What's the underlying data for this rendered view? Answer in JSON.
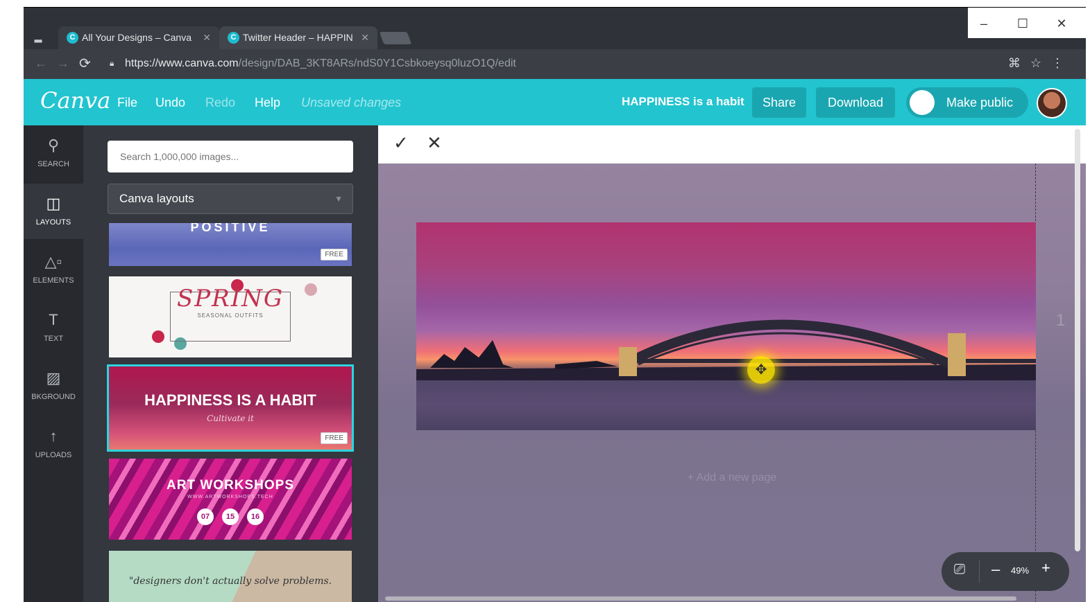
{
  "browser": {
    "tabs": [
      {
        "title": "All Your Designs – Canva",
        "favicon": "C"
      },
      {
        "title": "Twitter Header – HAPPIN",
        "favicon": "C"
      }
    ],
    "url_host": "https://www.canva.com",
    "url_path": "/design/DAB_3KT8ARs/ndS0Y1Csbkoeysq0luzO1Q/edit",
    "controls": {
      "minimize": "–",
      "maximize": "☐",
      "close": "✕"
    }
  },
  "header": {
    "logo": "Canva",
    "menu": {
      "file": "File",
      "undo": "Undo",
      "redo": "Redo",
      "help": "Help"
    },
    "status": "Unsaved changes",
    "design_title": "HAPPINESS is a habit",
    "share": "Share",
    "download": "Download",
    "make_public": "Make public",
    "accent": "#22c4cf"
  },
  "rail": [
    {
      "label": "SEARCH",
      "icon": "search-icon"
    },
    {
      "label": "LAYOUTS",
      "icon": "layouts-icon"
    },
    {
      "label": "ELEMENTS",
      "icon": "elements-icon"
    },
    {
      "label": "TEXT",
      "icon": "text-icon"
    },
    {
      "label": "BKGROUND",
      "icon": "background-icon"
    },
    {
      "label": "UPLOADS",
      "icon": "uploads-icon"
    }
  ],
  "panel": {
    "search_placeholder": "Search 1,000,000 images...",
    "dropdown": "Canva layouts",
    "free_badge": "FREE",
    "cards": {
      "positive": "POSITIVE",
      "spring": "SPRING",
      "spring_sub": "SEASONAL OUTFITS",
      "happiness": "HAPPINESS IS A HABIT",
      "happiness_sub": "Cultivate it",
      "art": "ART WORKSHOPS",
      "art_site": "WWW.ARTWORKSHOPS.TECH",
      "art_nums": [
        "07",
        "15",
        "16"
      ],
      "quote": "\"designers don't actually solve problems."
    }
  },
  "editor": {
    "page_number": "1",
    "add_page": "+ Add a new page",
    "zoom": "49%"
  }
}
